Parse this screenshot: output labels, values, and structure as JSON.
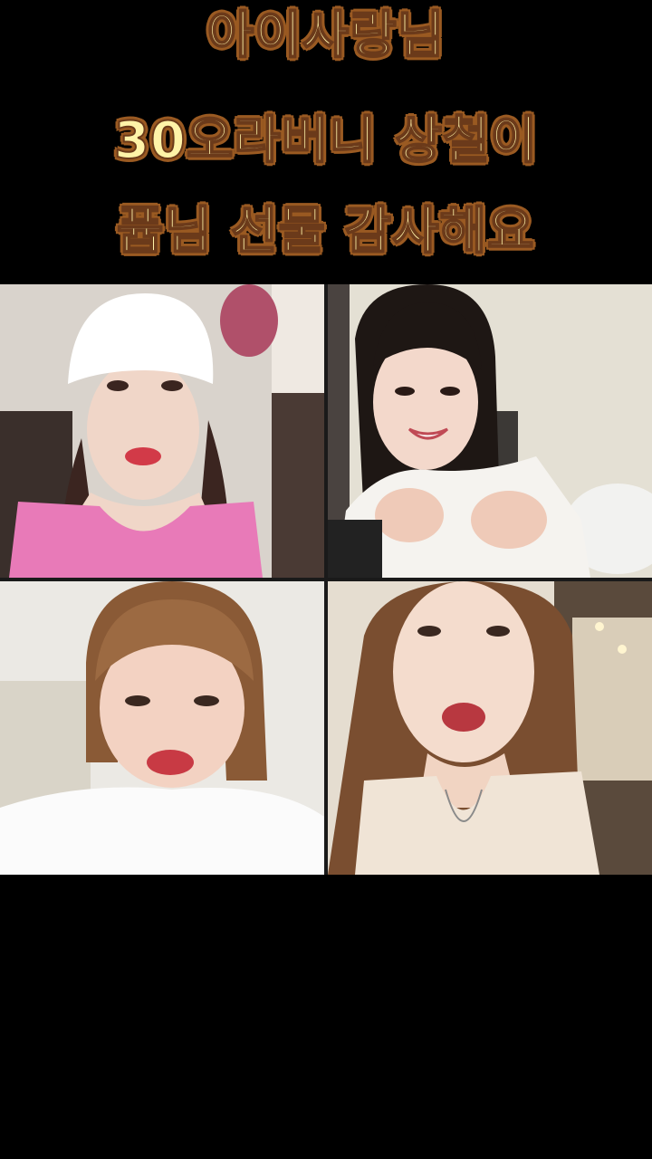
{
  "captions": {
    "line1": "아이사랑님",
    "line2": "30오라버니 상철이",
    "line3": "퓹님 선물 감사해요"
  },
  "participants": [
    {
      "tile": "top-left",
      "description_icon": "person-white-cap-pink-top"
    },
    {
      "tile": "top-right",
      "description_icon": "person-black-hair-white-top"
    },
    {
      "tile": "bottom-left",
      "description_icon": "person-brown-bangs-white-tee"
    },
    {
      "tile": "bottom-right",
      "description_icon": "person-long-brown-hair-cream-blouse"
    }
  ],
  "colors": {
    "caption_fill": "#fff3a8",
    "caption_outline": "#9a5a22",
    "background": "#000000"
  }
}
